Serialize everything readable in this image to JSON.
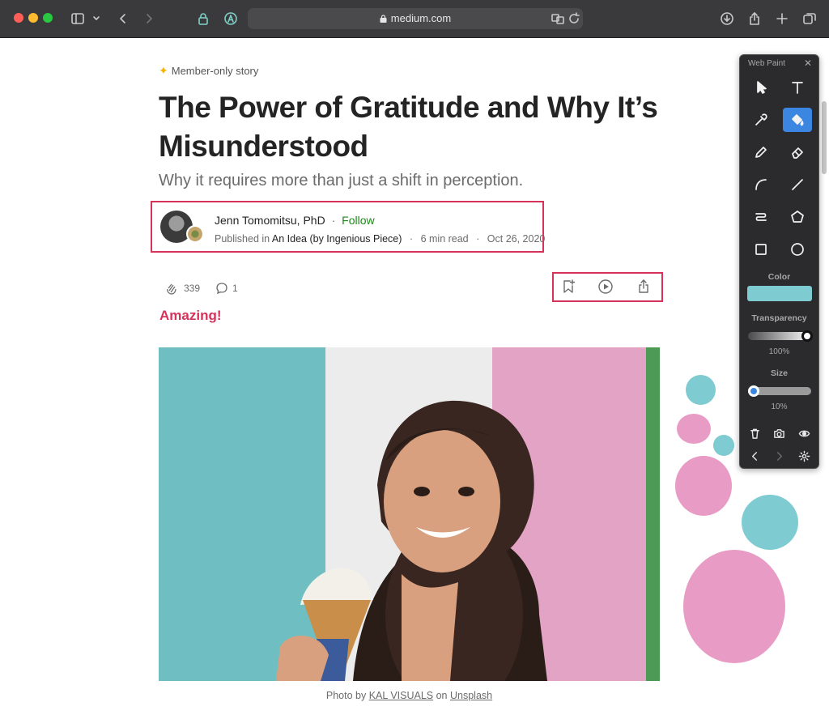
{
  "browser": {
    "url": "medium.com"
  },
  "article": {
    "member_label": "Member-only story",
    "title": "The Power of Gratitude and Why It’s Misunderstood",
    "subtitle": "Why it requires more than just a shift in perception.",
    "author_name": "Jenn Tomomitsu, PhD",
    "separator": "·",
    "follow_label": "Follow",
    "published_in_label": "Published in",
    "publication": "An Idea (by Ingenious Piece)",
    "read_time": "6 min read",
    "date": "Oct 26, 2020",
    "claps": "339",
    "comments": "1",
    "annotation": "Amazing!",
    "caption": {
      "prefix": "Photo by",
      "photographer": "KAL VISUALS",
      "on": "on",
      "source": "Unsplash"
    }
  },
  "web_paint": {
    "title": "Web Paint",
    "close": "✕",
    "tools": [
      "select",
      "text",
      "eyedropper",
      "fill",
      "pencil",
      "eraser",
      "curve",
      "line",
      "path",
      "polygon",
      "rectangle",
      "ellipse"
    ],
    "active_tool": "fill",
    "color_label": "Color",
    "color": "#7ecbd2",
    "transparency_label": "Transparency",
    "transparency_value": "100%",
    "transparency": 1.0,
    "size_label": "Size",
    "size_value": "10%",
    "size": 0.1,
    "footer_icons": [
      "trash-icon",
      "camera-icon",
      "eye-icon",
      "back-icon",
      "forward-icon",
      "settings-icon"
    ]
  },
  "colors": {
    "accent_red": "#d6325a",
    "follow_green": "#1a8917",
    "paint_teal": "#7ecbd2",
    "paint_pink": "#e89bc4"
  }
}
